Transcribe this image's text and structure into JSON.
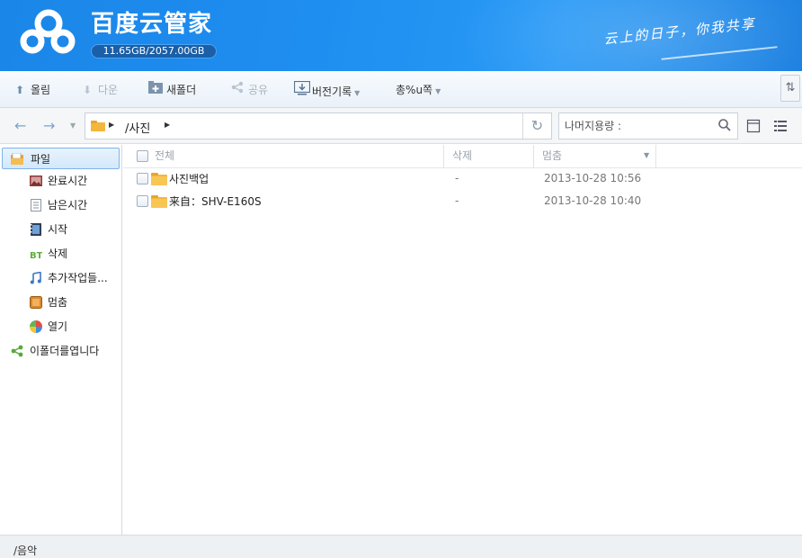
{
  "header": {
    "app_title": "百度云管家",
    "quota": "11.65GB/2057.00GB",
    "slogan": "云上的日子，你我共享",
    "brand_color": "#1e8ef0"
  },
  "toolbar": {
    "upload": "올림",
    "download": "다운",
    "new_folder": "새폴더",
    "share": "공유",
    "version_history": "버전기록",
    "more": "총%u쪽"
  },
  "address": {
    "path": "/사진",
    "search_placeholder": "나머지용량 :"
  },
  "sidebar": {
    "items": [
      {
        "label": "파일",
        "icon": "files-icon"
      },
      {
        "label": "완료시간",
        "icon": "image-icon"
      },
      {
        "label": "남은시간",
        "icon": "document-icon"
      },
      {
        "label": "시작",
        "icon": "video-icon"
      },
      {
        "label": "삭제",
        "icon": "bt-icon"
      },
      {
        "label": "추가작업들...",
        "icon": "music-icon"
      },
      {
        "label": "멈춤",
        "icon": "archive-icon"
      },
      {
        "label": "열기",
        "icon": "apps-icon"
      },
      {
        "label": "이폴더를엽니다",
        "icon": "share-icon"
      }
    ]
  },
  "list": {
    "columns": [
      "전체",
      "삭제",
      "멈춤"
    ],
    "rows": [
      {
        "name": "사진백업",
        "size": "-",
        "date": "2013-10-28 10:56"
      },
      {
        "name": "来自：SHV-E160S",
        "size": "-",
        "date": "2013-10-28 10:40"
      }
    ]
  },
  "status": {
    "text": "/음악"
  }
}
